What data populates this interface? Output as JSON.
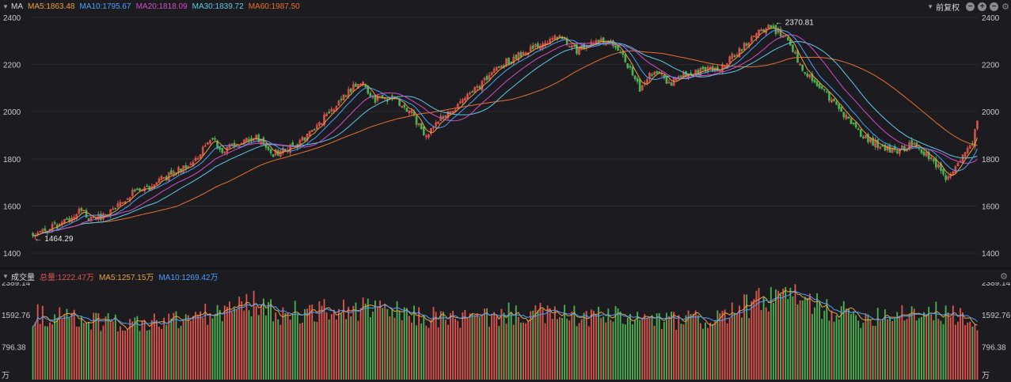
{
  "price_header": {
    "indicator": "MA",
    "ma5": "MA5:1863.48",
    "ma10": "MA10:1795.67",
    "ma20": "MA20:1818.09",
    "ma30": "MA30:1839.72",
    "ma60": "MA60:1987.50",
    "adjust_label": "前复权"
  },
  "volume_header": {
    "indicator": "成交量",
    "total": "总量:1222.47万",
    "ma5": "MA5:1257.15万",
    "ma10": "MA10:1269.42万"
  },
  "colors": {
    "background": "#1c1c20",
    "up": "#e0544e",
    "down": "#4cb050",
    "ma5": "#e8a040",
    "ma10": "#4a9fff",
    "ma20": "#d34cc8",
    "ma30": "#5cc8e8",
    "ma60": "#e8702c",
    "grid": "#2a2a30",
    "axis_text": "#c8c8cc"
  },
  "icons": [
    "chevron-down-icon",
    "minus-circle-icon",
    "plus-circle-icon",
    "close-circle-icon",
    "gear-icon"
  ],
  "chart_data": [
    {
      "type": "candlestick",
      "name": "price",
      "ylim": [
        1340,
        2420
      ],
      "y_ticks": [
        "2400",
        "2200",
        "2000",
        "1800",
        "1600",
        "1400"
      ],
      "annotations": [
        {
          "text": "1464.29",
          "at": "low"
        },
        {
          "text": "2370.81",
          "at": "high"
        }
      ],
      "trend_points": [
        [
          0,
          1475
        ],
        [
          14,
          1535
        ],
        [
          20,
          1590
        ],
        [
          24,
          1540
        ],
        [
          30,
          1565
        ],
        [
          40,
          1650
        ],
        [
          48,
          1680
        ],
        [
          56,
          1730
        ],
        [
          66,
          1790
        ],
        [
          74,
          1880
        ],
        [
          78,
          1840
        ],
        [
          84,
          1860
        ],
        [
          92,
          1890
        ],
        [
          98,
          1820
        ],
        [
          108,
          1850
        ],
        [
          116,
          1930
        ],
        [
          124,
          2020
        ],
        [
          132,
          2110
        ],
        [
          136,
          2130
        ],
        [
          140,
          2050
        ],
        [
          148,
          2060
        ],
        [
          156,
          1990
        ],
        [
          162,
          1900
        ],
        [
          168,
          1970
        ],
        [
          176,
          2030
        ],
        [
          184,
          2110
        ],
        [
          192,
          2190
        ],
        [
          200,
          2240
        ],
        [
          210,
          2290
        ],
        [
          218,
          2320
        ],
        [
          224,
          2260
        ],
        [
          232,
          2300
        ],
        [
          238,
          2290
        ],
        [
          244,
          2220
        ],
        [
          250,
          2100
        ],
        [
          256,
          2180
        ],
        [
          262,
          2120
        ],
        [
          268,
          2160
        ],
        [
          276,
          2170
        ],
        [
          284,
          2190
        ],
        [
          292,
          2270
        ],
        [
          298,
          2340
        ],
        [
          304,
          2360
        ],
        [
          310,
          2310
        ],
        [
          316,
          2200
        ],
        [
          322,
          2120
        ],
        [
          330,
          2040
        ],
        [
          336,
          1960
        ],
        [
          344,
          1880
        ],
        [
          350,
          1850
        ],
        [
          356,
          1830
        ],
        [
          362,
          1860
        ],
        [
          368,
          1820
        ],
        [
          372,
          1780
        ],
        [
          376,
          1720
        ],
        [
          380,
          1760
        ],
        [
          384,
          1830
        ],
        [
          387,
          1865
        ],
        [
          389,
          1960
        ]
      ],
      "ma_final": {
        "ma5": 1863.48,
        "ma10": 1795.67,
        "ma20": 1818.09,
        "ma30": 1839.72,
        "ma60": 1987.5
      }
    },
    {
      "type": "bar",
      "name": "volume",
      "unit": "万",
      "ylim": [
        0,
        2389.14
      ],
      "y_ticks": [
        "2389.14",
        "1592.76",
        "796.38",
        "万"
      ],
      "level_points": [
        [
          0,
          1600
        ],
        [
          20,
          1500
        ],
        [
          40,
          1380
        ],
        [
          60,
          1480
        ],
        [
          80,
          1700
        ],
        [
          90,
          1900
        ],
        [
          100,
          1650
        ],
        [
          120,
          1700
        ],
        [
          140,
          1750
        ],
        [
          160,
          1550
        ],
        [
          180,
          1500
        ],
        [
          200,
          1650
        ],
        [
          220,
          1580
        ],
        [
          240,
          1550
        ],
        [
          260,
          1450
        ],
        [
          280,
          1500
        ],
        [
          300,
          1950
        ],
        [
          310,
          2100
        ],
        [
          320,
          1900
        ],
        [
          340,
          1550
        ],
        [
          360,
          1700
        ],
        [
          372,
          1650
        ],
        [
          380,
          1600
        ],
        [
          389,
          1300
        ]
      ],
      "last_value": 1222.47
    }
  ]
}
